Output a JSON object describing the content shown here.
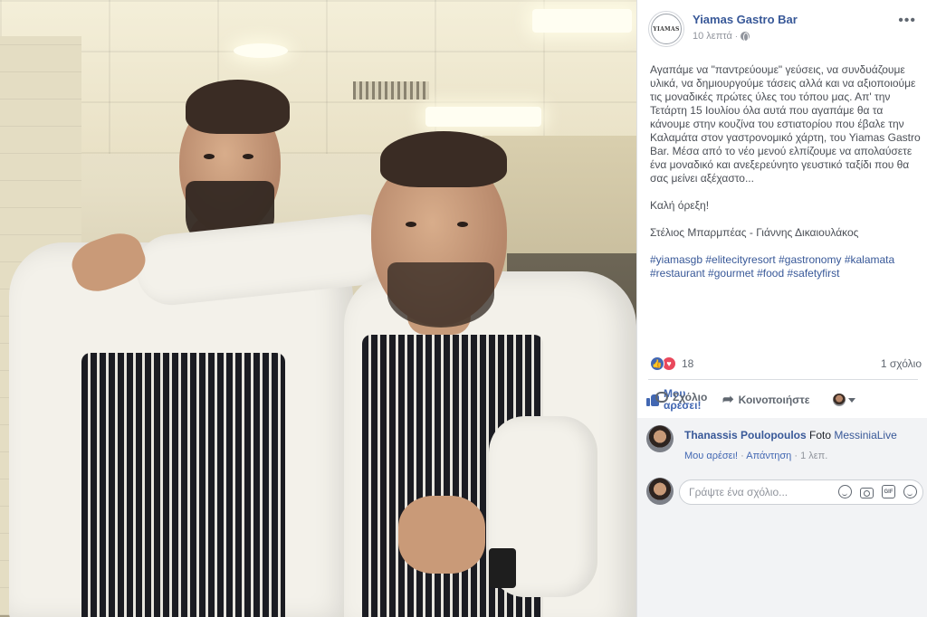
{
  "post": {
    "page_name": "Yiamas Gastro Bar",
    "page_logo_text": "YIAMAS",
    "time": "10 λεπτά",
    "meta_separator": "·",
    "more_icon": "ellipsis-icon",
    "text": {
      "paragraph1": "Αγαπάμε να \"παντρεύουμε\" γεύσεις, να συνδυάζουμε υλικά, να δημιουργούμε τάσεις αλλά και να αξιοποιούμε τις μοναδικές πρώτες ύλες του τόπου μας. Απ' την Τετάρτη 15 Ιουλίου όλα αυτά που αγαπάμε θα τα κάνουμε στην κουζίνα του εστιατορίου που έβαλε την Καλαμάτα στον γαστρονομικό χάρτη, του Yiamas Gastro Bar. Μέσα από το νέο μενού ελπίζουμε να απολαύσετε ένα μοναδικό και ανεξερεύνητο γευστικό ταξίδι που θα σας μείνει αξέχαστο...",
      "paragraph2": "Καλή όρεξη!",
      "paragraph3": "Στέλιος Μπαρμπέας - Γιάννης Δικαιουλάκος",
      "hashtags": [
        "#yiamasgb",
        "#elitecityresort",
        "#gastronomy",
        "#kalamata",
        "#restaurant",
        "#gourmet",
        "#food",
        "#safetyfirst"
      ]
    },
    "reactions": {
      "count": "18",
      "comments": "1 σχόλιο"
    },
    "actions": {
      "like": "Μου αρέσει!",
      "comment": "Σχόλιο",
      "share": "Κοινοποιήστε"
    }
  },
  "comments": [
    {
      "author": "Thanassis Poulopoulos",
      "text": "Foto",
      "link": "MessiniaLive",
      "like": "Μου αρέσει!",
      "reply": "Απάντηση",
      "time": "1 λεπ."
    }
  ],
  "composer": {
    "placeholder": "Γράψτε ένα σχόλιο...",
    "icons": [
      "smiley-icon",
      "camera-icon",
      "gif-icon",
      "sticker-icon"
    ],
    "gif_label": "GIF"
  },
  "colors": {
    "link": "#385898",
    "like_blue": "#4267b2",
    "love_red": "#e9485c",
    "muted": "#90949c"
  }
}
